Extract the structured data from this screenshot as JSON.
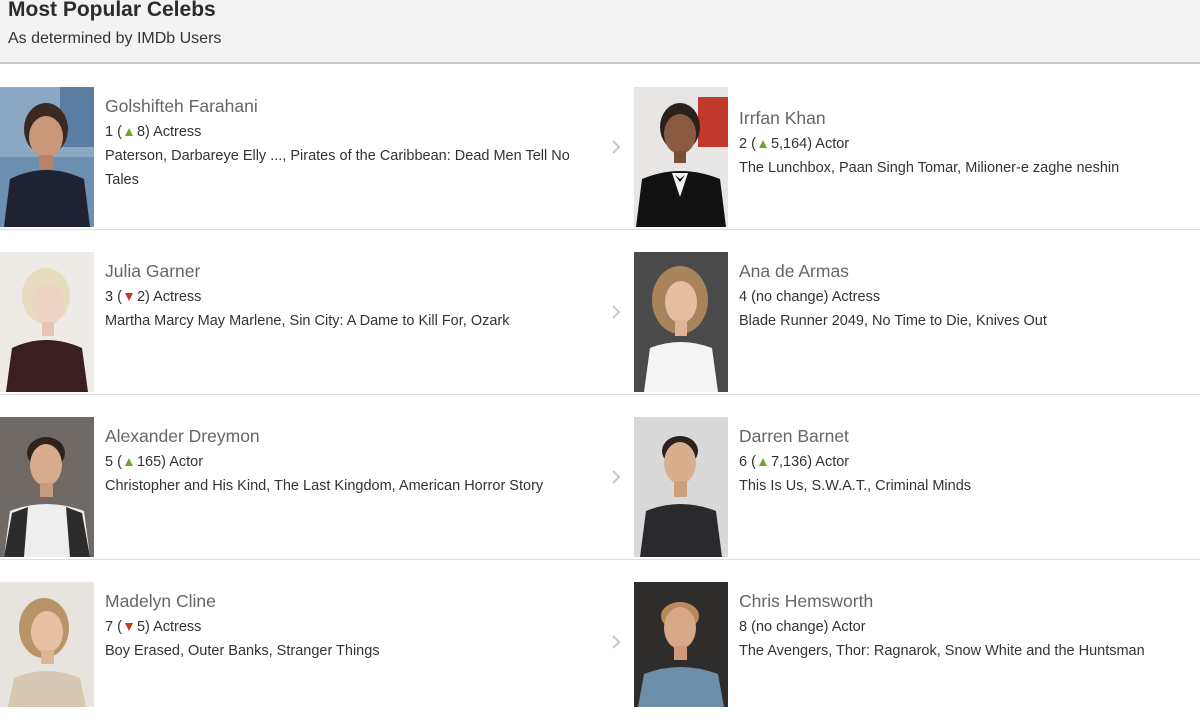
{
  "header": {
    "title": "Most Popular Celebs",
    "subtitle": "As determined by IMDb Users"
  },
  "colors": {
    "up": "#6aa728",
    "down": "#c23b22",
    "name": "#666666"
  },
  "celebs": [
    {
      "name": "Golshifteh Farahani",
      "rank": "1",
      "trend": "up",
      "change": "8",
      "role": "Actress",
      "known_for": "Paterson, Darbareye Elly ..., Pirates of the Caribbean: Dead Men Tell No Tales"
    },
    {
      "name": "Irrfan Khan",
      "rank": "2",
      "trend": "up",
      "change": "5,164",
      "role": "Actor",
      "known_for": "The Lunchbox, Paan Singh Tomar, Milioner-e zaghe neshin"
    },
    {
      "name": "Julia Garner",
      "rank": "3",
      "trend": "down",
      "change": "2",
      "role": "Actress",
      "known_for": "Martha Marcy May Marlene, Sin City: A Dame to Kill For, Ozark"
    },
    {
      "name": "Ana de Armas",
      "rank": "4",
      "trend": "none",
      "change": "no change",
      "role": "Actress",
      "known_for": "Blade Runner 2049, No Time to Die, Knives Out"
    },
    {
      "name": "Alexander Dreymon",
      "rank": "5",
      "trend": "up",
      "change": "165",
      "role": "Actor",
      "known_for": "Christopher and His Kind, The Last Kingdom, American Horror Story"
    },
    {
      "name": "Darren Barnet",
      "rank": "6",
      "trend": "up",
      "change": "7,136",
      "role": "Actor",
      "known_for": "This Is Us, S.W.A.T., Criminal Minds"
    },
    {
      "name": "Madelyn Cline",
      "rank": "7",
      "trend": "down",
      "change": "5",
      "role": "Actress",
      "known_for": "Boy Erased, Outer Banks, Stranger Things"
    },
    {
      "name": "Chris Hemsworth",
      "rank": "8",
      "trend": "none",
      "change": "no change",
      "role": "Actor",
      "known_for": "The Avengers, Thor: Ragnarok, Snow White and the Huntsman"
    }
  ]
}
